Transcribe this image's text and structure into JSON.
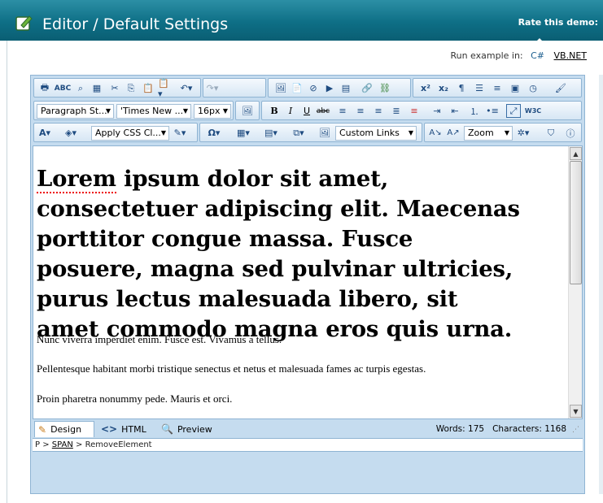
{
  "header": {
    "title": "Editor / Default Settings",
    "rate_label": "Rate this demo:"
  },
  "run": {
    "label": "Run example in:",
    "cs": "C#",
    "vb": "VB.NET"
  },
  "toolbar": {
    "paragraph_style": "Paragraph St...",
    "font_name": "'Times New ...",
    "font_size": "16px",
    "css_class": "Apply CSS Cl...",
    "custom_links": "Custom Links",
    "zoom": "Zoom"
  },
  "content": {
    "heading_first": "Lorem",
    "heading_rest": " ipsum dolor sit amet, consectetuer adipiscing elit. Maecenas porttitor congue massa. Fusce posuere, magna sed pulvinar ultricies, purus lectus malesuada libero, sit amet commodo magna eros quis urna.",
    "p1": "Nunc viverra imperdiet enim. Fusce est. Vivamus a tellus.",
    "p2": "Pellentesque habitant morbi tristique senectus et netus et malesuada fames ac turpis egestas.",
    "p3": "Proin pharetra nonummy pede. Mauris et orci."
  },
  "modes": {
    "design": "Design",
    "html": "HTML",
    "preview": "Preview"
  },
  "status": {
    "words": "Words: 175",
    "characters": "Characters: 1168"
  },
  "path": {
    "p": "P",
    "sep1": ">",
    "span": "SPAN",
    "sep2": ">",
    "remove": "RemoveElement"
  },
  "colors": {
    "header": "#0e6f86",
    "toolbar_bg": "#c5dcef",
    "border": "#8fb4d3"
  }
}
